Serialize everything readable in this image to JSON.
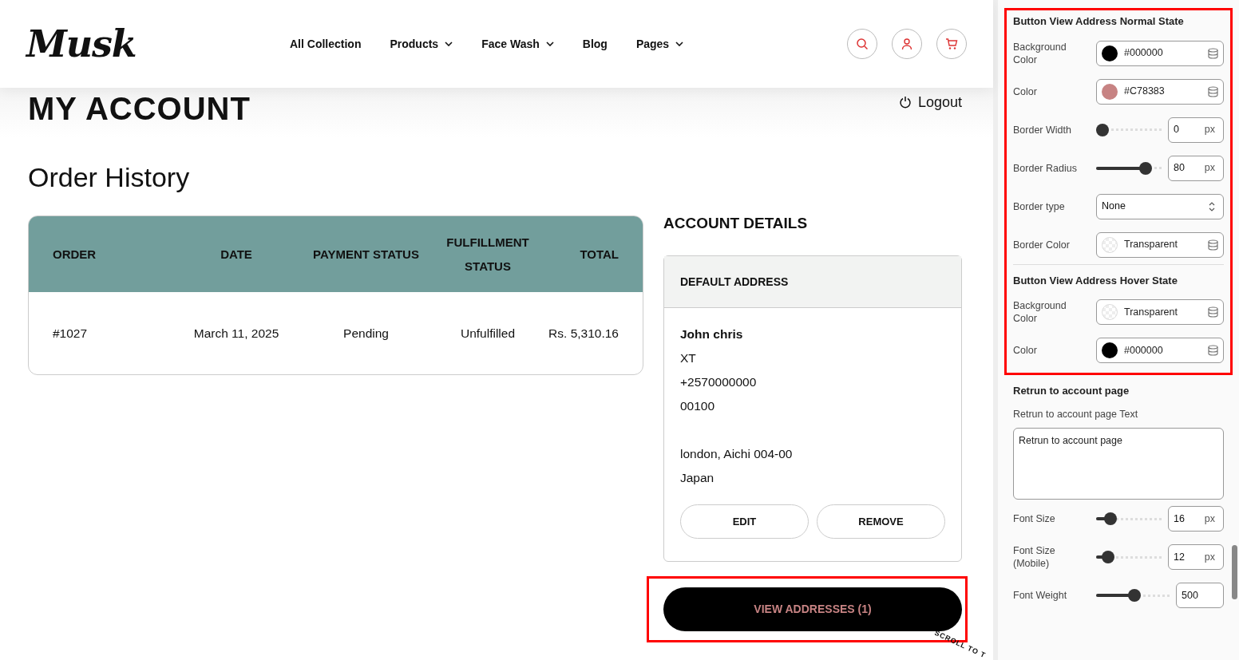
{
  "header": {
    "logo": "Musk",
    "nav": [
      {
        "label": "All Collection",
        "dropdown": false
      },
      {
        "label": "Products",
        "dropdown": true
      },
      {
        "label": "Face Wash",
        "dropdown": true
      },
      {
        "label": "Blog",
        "dropdown": false
      },
      {
        "label": "Pages",
        "dropdown": true
      }
    ]
  },
  "page": {
    "title": "MY ACCOUNT",
    "logout": "Logout",
    "order_history_title": "Order History"
  },
  "orders": {
    "columns": [
      "ORDER",
      "DATE",
      "PAYMENT STATUS",
      "FULFILLMENT STATUS",
      "TOTAL"
    ],
    "rows": [
      [
        "#1027",
        "March 11, 2025",
        "Pending",
        "Unfulfilled",
        "Rs. 5,310.16"
      ]
    ]
  },
  "account": {
    "title": "ACCOUNT DETAILS",
    "address_title": "DEFAULT ADDRESS",
    "address_lines": [
      "John chris",
      "XT",
      "+2570000000",
      "00100"
    ],
    "address_lines_2": [
      "london, Aichi 004-00",
      "Japan"
    ],
    "buttons": [
      "EDIT",
      "REMOVE"
    ],
    "view_button": {
      "label": "VIEW ADDRESSES (1)",
      "highlighted": true
    }
  },
  "scroll_badge": "SCROLL TO T",
  "panel": {
    "sections": [
      {
        "title": "Button View Address Normal State",
        "highlighted": true,
        "fields": [
          {
            "kind": "color",
            "label": "Background Color",
            "value": "#000000",
            "color": "#000000"
          },
          {
            "kind": "color",
            "label": "Color",
            "value": "#C78383",
            "color": "#c78383"
          },
          {
            "kind": "slider",
            "label": "Border Width",
            "value": "0",
            "unit": "px",
            "level": 0
          },
          {
            "kind": "slider",
            "label": "Border Radius",
            "value": "80",
            "unit": "px",
            "level": 0.75
          },
          {
            "kind": "select",
            "label": "Border type",
            "value": "None"
          },
          {
            "kind": "transparent",
            "label": "Border Color",
            "value": "Transparent"
          }
        ]
      },
      {
        "title": "Button View Address Hover State",
        "highlighted": true,
        "fields": [
          {
            "kind": "transparent",
            "label": "Background Color",
            "value": "Transparent"
          },
          {
            "kind": "color",
            "label": "Color",
            "value": "#000000",
            "color": "#000000"
          }
        ]
      },
      {
        "title": "Retrun to account page",
        "highlighted": false,
        "fields": [
          {
            "kind": "textarea",
            "label": "Retrun to account page Text",
            "value": "Retrun to account page"
          },
          {
            "kind": "slider",
            "label": "Font Size",
            "value": "16",
            "unit": "px",
            "level": 0.22
          },
          {
            "kind": "slider",
            "label": "Font Size (Mobile)",
            "value": "12",
            "unit": "px",
            "level": 0.18
          },
          {
            "kind": "slider_wide",
            "label": "Font Weight",
            "value": "500",
            "level": 0.52
          }
        ]
      }
    ]
  }
}
